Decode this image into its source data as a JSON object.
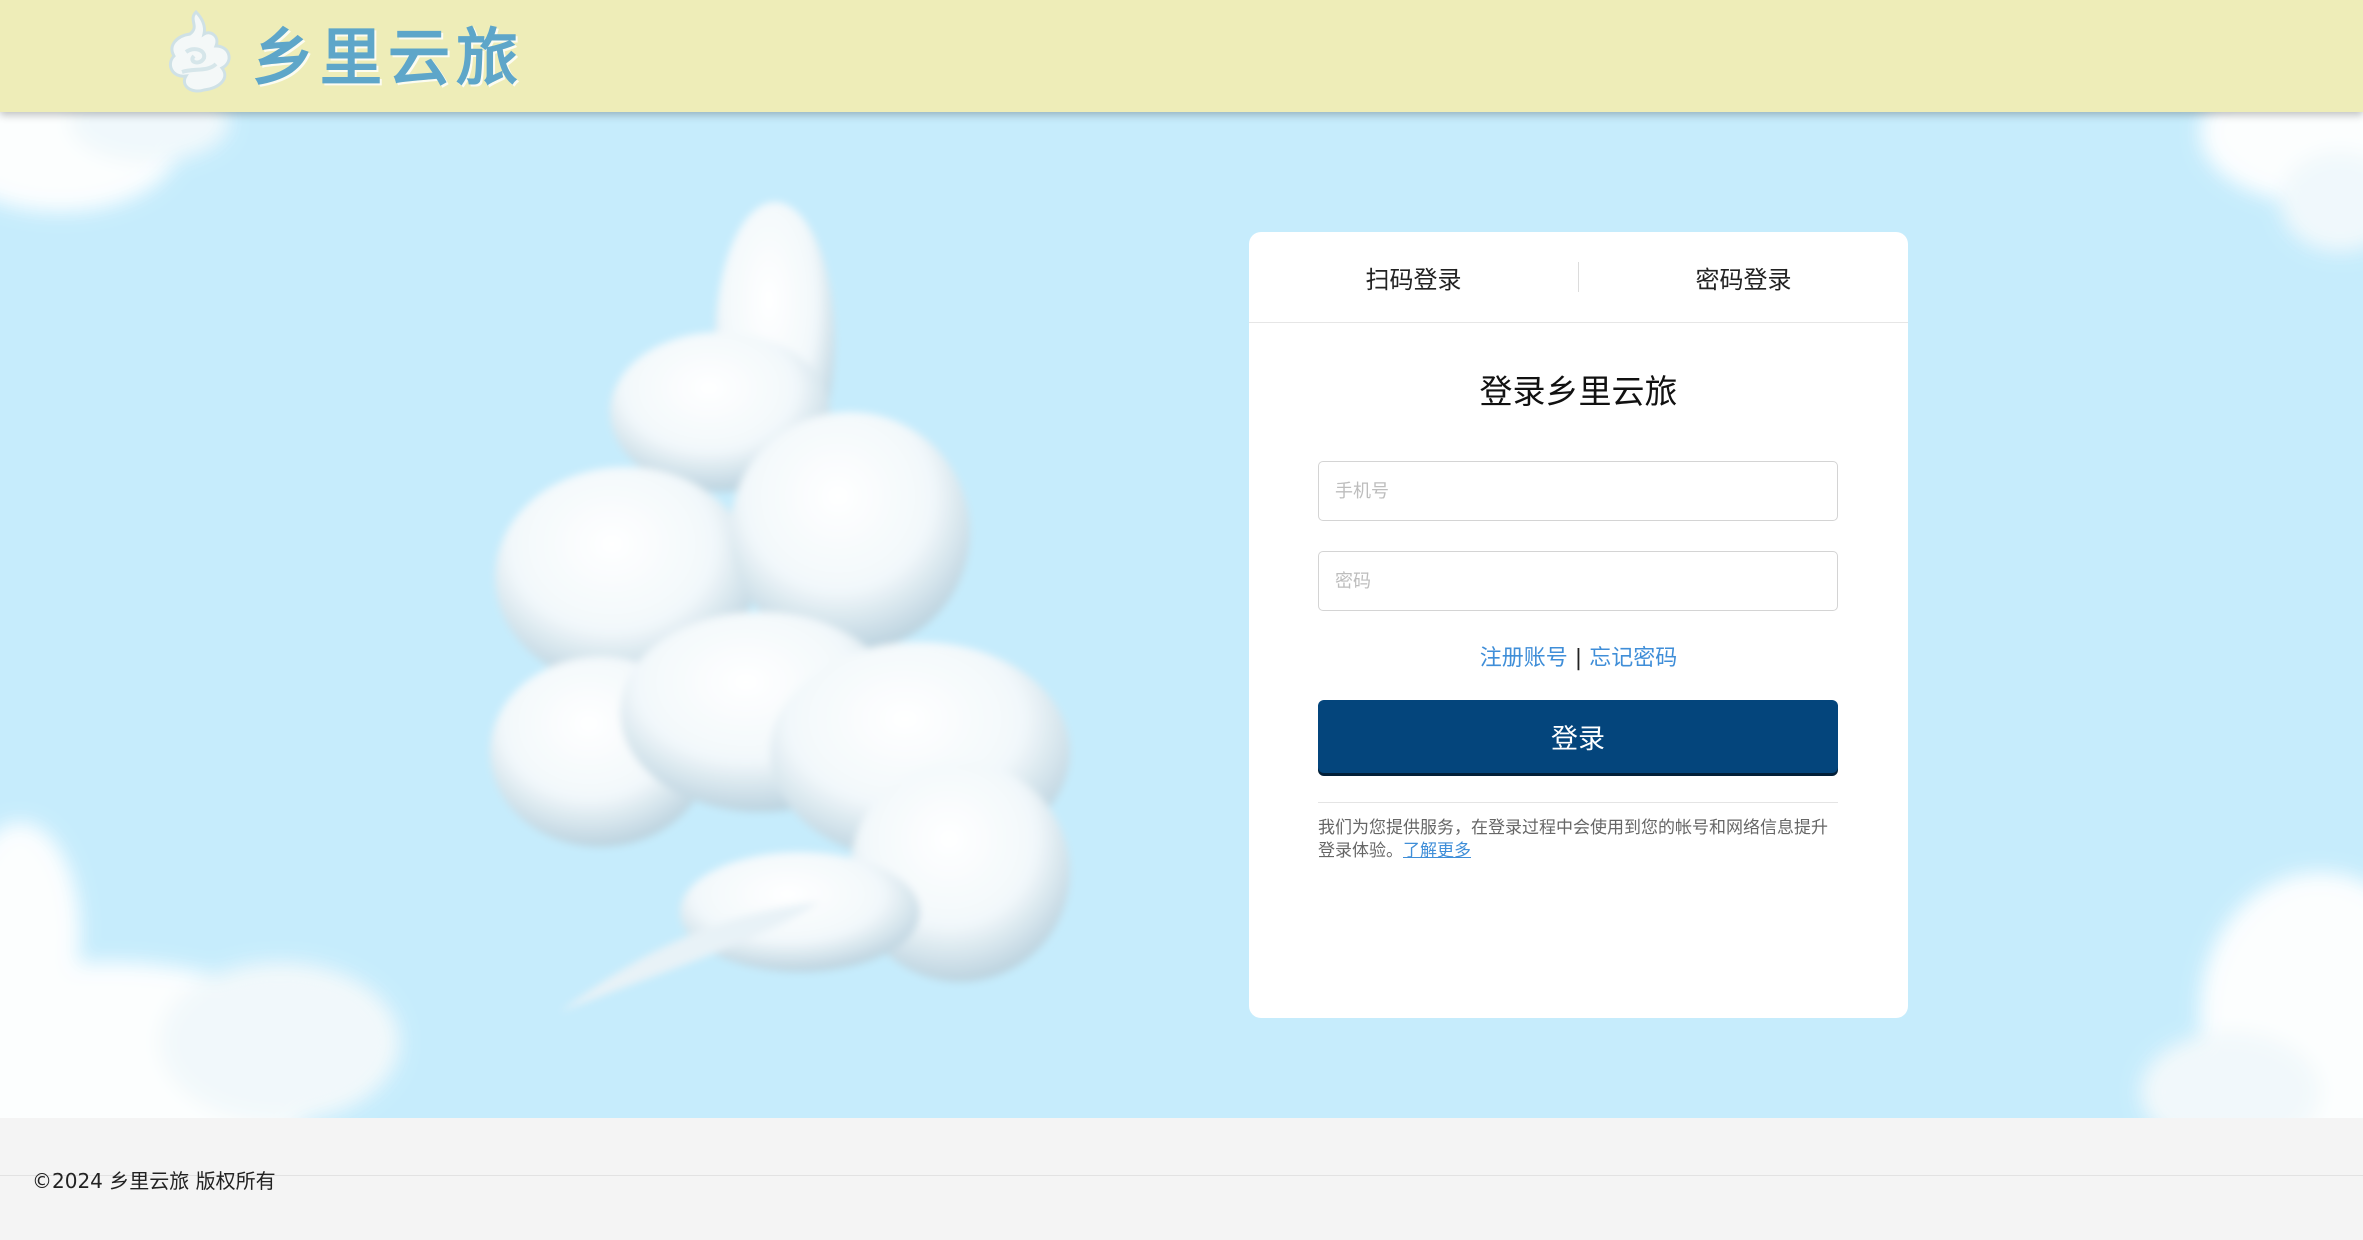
{
  "header": {
    "brand_name": "乡里云旅"
  },
  "login": {
    "tabs": [
      {
        "label": "扫码登录"
      },
      {
        "label": "密码登录"
      }
    ],
    "title": "登录乡里云旅",
    "phone_placeholder": "手机号",
    "password_placeholder": "密码",
    "register_link": "注册账号",
    "link_separator": "|",
    "forgot_link": "忘记密码",
    "submit_label": "登录",
    "notice_text": "我们为您提供服务，在登录过程中会使用到您的帐号和网络信息提升登录体验。",
    "learn_more": "了解更多"
  },
  "footer": {
    "copyright": "©2024 乡里云旅 版权所有"
  },
  "colors": {
    "header_bg": "#eeedb8",
    "sky": "#c6ecfc",
    "brand": "#5ea6c9",
    "button": "#04457c",
    "link": "#3f8ed8"
  }
}
